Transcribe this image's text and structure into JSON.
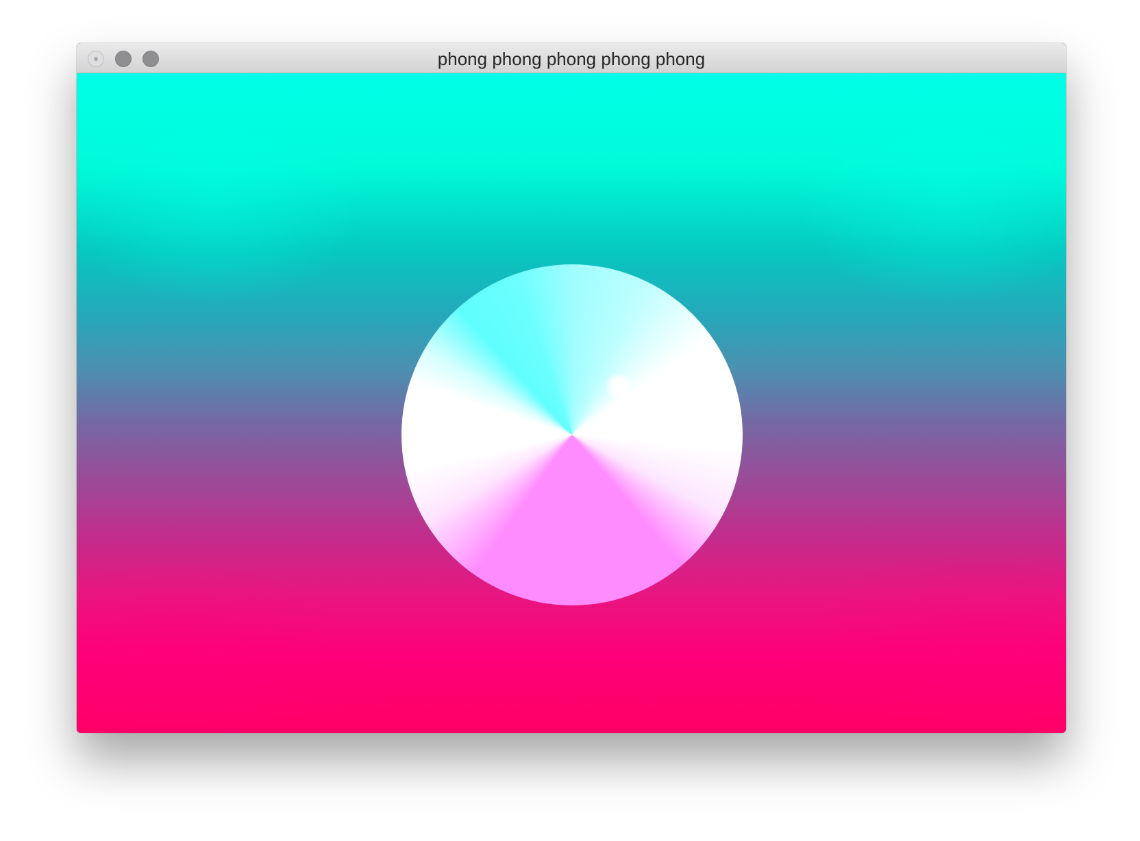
{
  "window": {
    "title": "phong phong phong phong phong"
  },
  "colors": {
    "top": "#00ffe8",
    "middle": "#7568a3",
    "bottom": "#ff0066",
    "sphere_cyan": "#5ffefe",
    "sphere_magenta": "#ff8cfe"
  }
}
